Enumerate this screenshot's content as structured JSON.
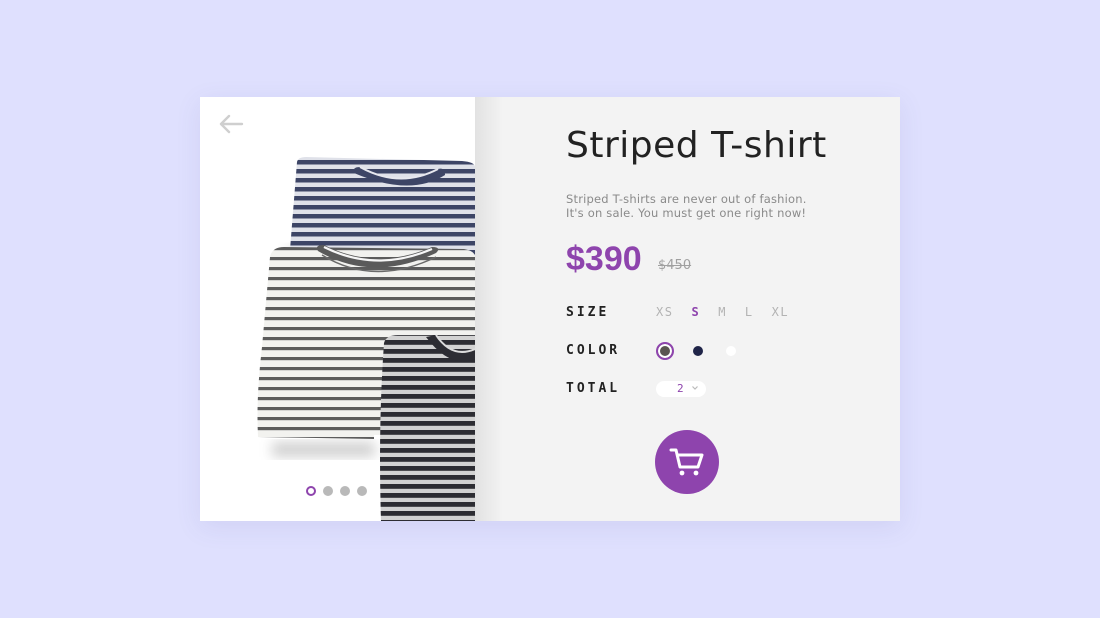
{
  "product": {
    "title": "Striped T-shirt",
    "description_line1": "Striped T-shirts are never out of fashion.",
    "description_line2": "It's on sale. You must get one right now!",
    "price": "$390",
    "old_price": "$450"
  },
  "options": {
    "size_label": "SIZE",
    "sizes": [
      "XS",
      "S",
      "M",
      "L",
      "XL"
    ],
    "selected_size": "S",
    "color_label": "COLOR",
    "colors": [
      "#5a5550",
      "#1f2448",
      "#ffffff"
    ],
    "selected_color": "#5a5550",
    "total_label": "TOTAL",
    "quantity": "2"
  },
  "gallery": {
    "slide_count": 4,
    "active_slide": 1
  },
  "theme": {
    "accent": "#8e44ad",
    "background": "#dfe0fe"
  },
  "icons": {
    "back": "arrow-left-icon",
    "cart": "shopping-cart-icon",
    "quantity_dropdown": "chevron-down-icon"
  }
}
